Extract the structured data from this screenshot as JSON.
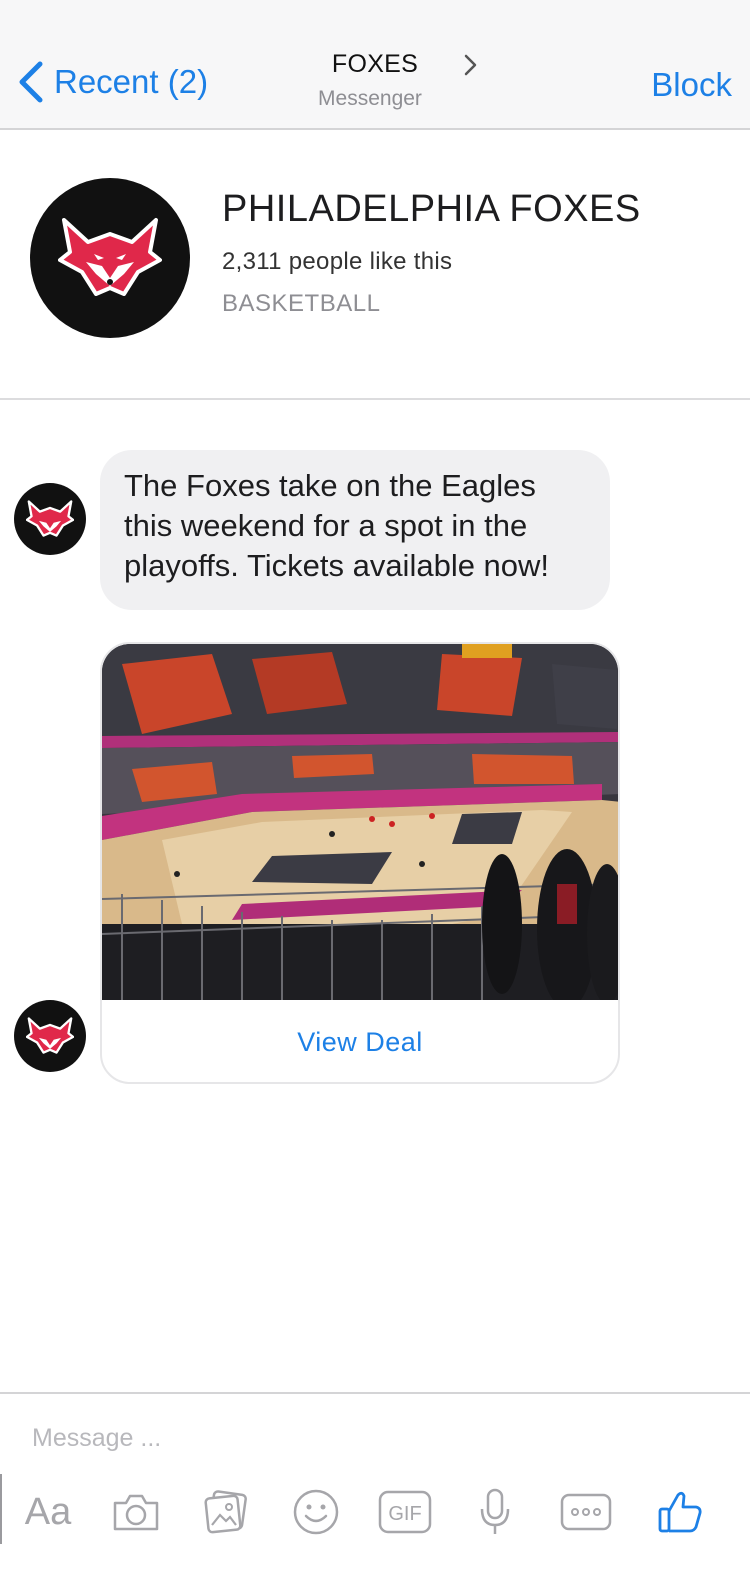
{
  "nav": {
    "back_label": "Recent (2)",
    "title": "FOXES",
    "subtitle": "Messenger",
    "block_label": "Block"
  },
  "profile": {
    "name": "PHILADELPHIA FOXES",
    "likes": "2,311 people like this",
    "category": "BASKETBALL"
  },
  "messages": {
    "text": "The Foxes take on the Eagles this weekend for a spot in the playoffs. Tickets available now!",
    "card_action": "View Deal"
  },
  "composer": {
    "placeholder": "Message ...",
    "tools": [
      "Aa",
      "camera-icon",
      "gallery-icon",
      "emoji-icon",
      "GIF",
      "microphone-icon",
      "more-icon",
      "like-icon"
    ]
  },
  "colors": {
    "accent": "#1d80e6",
    "fox_red": "#e0284a",
    "bubble_bg": "#f0f0f2"
  }
}
